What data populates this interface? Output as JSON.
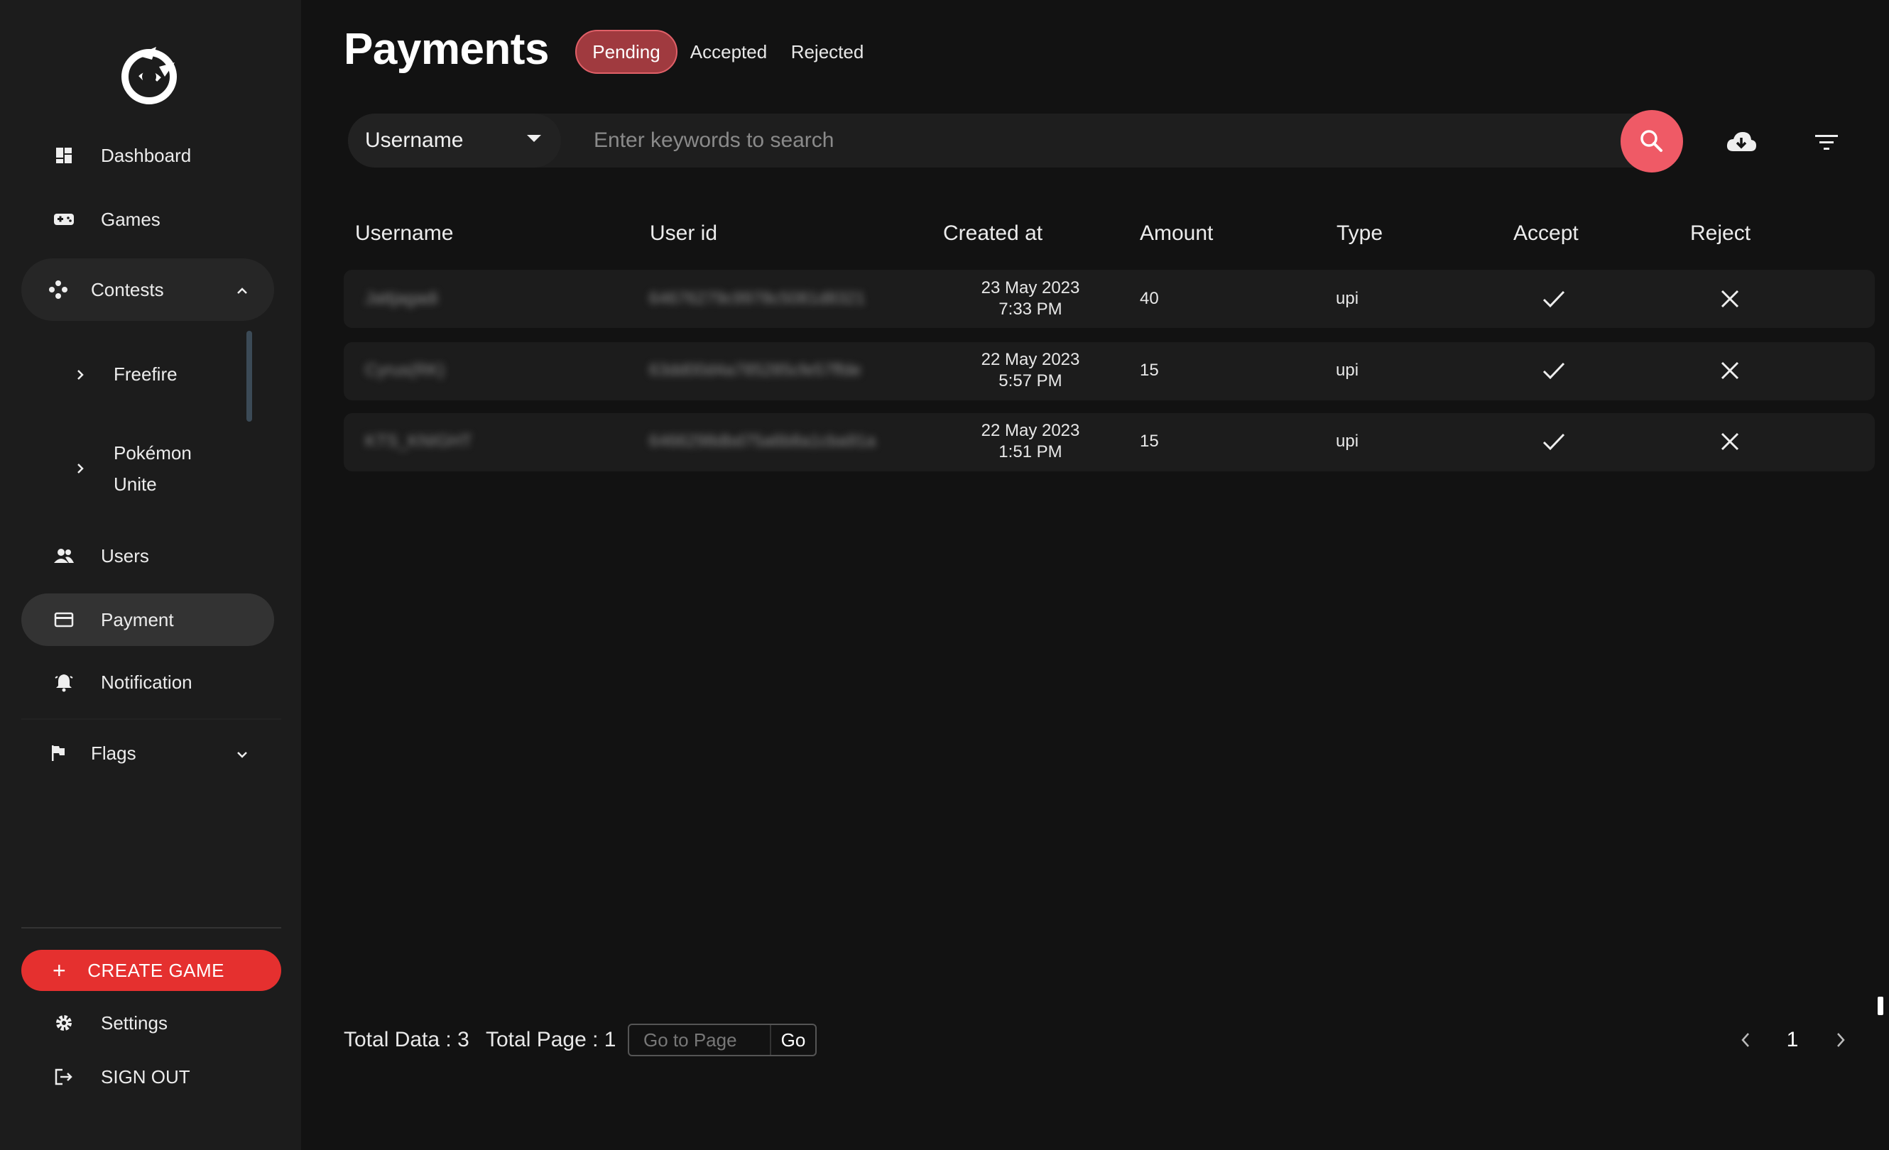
{
  "sidebar": {
    "items": {
      "dashboard": "Dashboard",
      "games": "Games",
      "contests": "Contests",
      "freefire": "Freefire",
      "pokemon_line1": "Pokémon",
      "pokemon_line2": "Unite",
      "users": "Users",
      "payment": "Payment",
      "notification": "Notification",
      "flags": "Flags"
    },
    "create_game": "CREATE GAME",
    "settings": "Settings",
    "sign_out": "SIGN OUT",
    "active_item": "payment"
  },
  "header": {
    "title": "Payments",
    "tabs": [
      {
        "label": "Pending",
        "active": true
      },
      {
        "label": "Accepted",
        "active": false
      },
      {
        "label": "Rejected",
        "active": false
      }
    ]
  },
  "search": {
    "field_selected": "Username",
    "placeholder": "Enter keywords to search"
  },
  "table": {
    "columns": [
      "Username",
      "User id",
      "Created at",
      "Amount",
      "Type",
      "Accept",
      "Reject"
    ],
    "rows": [
      {
        "username": "Jattjagadi",
        "user_id": "64676279c9978c5081d8321",
        "date": "23 May 2023",
        "time": "7:33 PM",
        "amount": "40",
        "type": "upi"
      },
      {
        "username": "Cyrus(RK)",
        "user_id": "63dd00d4a785285cfe57ffde",
        "date": "22 May 2023",
        "time": "5:57 PM",
        "amount": "15",
        "type": "upi"
      },
      {
        "username": "KTS_KNIGHT",
        "user_id": "6466298dbd75a6b8a1cba91a",
        "date": "22 May 2023",
        "time": "1:51 PM",
        "amount": "15",
        "type": "upi"
      }
    ]
  },
  "footer": {
    "total_data": "Total Data : 3",
    "total_page": "Total Page : 1",
    "goto_placeholder": "Go to Page",
    "go_label": "Go",
    "current_page": "1"
  },
  "colors": {
    "accent": "#e5302f",
    "search_button": "#ef5a66",
    "pending_tab": "#a03a3f"
  }
}
